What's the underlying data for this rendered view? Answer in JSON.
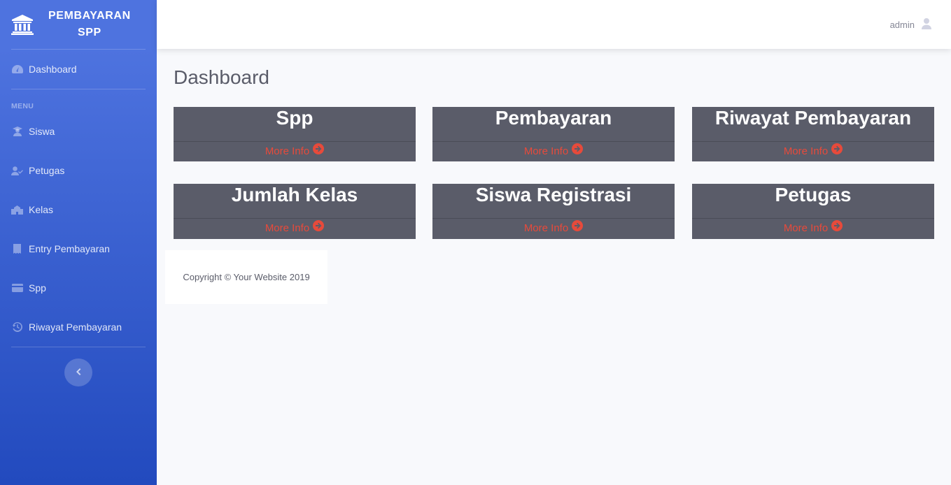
{
  "brand": {
    "line1": "PEMBAYARAN",
    "line2": "SPP",
    "icon": "bank-icon"
  },
  "sidebar": {
    "dashboard": {
      "label": "Dashboard",
      "icon": "tachometer-icon"
    },
    "heading": "MENU",
    "items": [
      {
        "label": "Siswa",
        "icon": "user-graduate-icon"
      },
      {
        "label": "Petugas",
        "icon": "user-check-icon"
      },
      {
        "label": "Kelas",
        "icon": "school-icon"
      },
      {
        "label": "Entry Pembayaran",
        "icon": "receipt-icon"
      },
      {
        "label": "Spp",
        "icon": "credit-card-icon"
      },
      {
        "label": "Riwayat Pembayaran",
        "icon": "history-icon"
      }
    ],
    "toggle_icon": "chevron-left-icon"
  },
  "topbar": {
    "username": "admin",
    "user_icon": "user-icon"
  },
  "page": {
    "title": "Dashboard"
  },
  "cards": [
    {
      "title": "Spp",
      "link": "More Info"
    },
    {
      "title": "Pembayaran",
      "link": "More Info"
    },
    {
      "title": "Riwayat Pembayaran",
      "link": "More Info"
    },
    {
      "title": "Jumlah Kelas",
      "link": "More Info"
    },
    {
      "title": "Siswa Registrasi",
      "link": "More Info"
    },
    {
      "title": "Petugas",
      "link": "More Info"
    }
  ],
  "footer": {
    "copyright": "Copyright © Your Website 2019"
  },
  "colors": {
    "sidebar_top": "#4e73df",
    "sidebar_bottom": "#224abe",
    "card_bg": "#5a5c69",
    "link": "#e74a3b"
  }
}
